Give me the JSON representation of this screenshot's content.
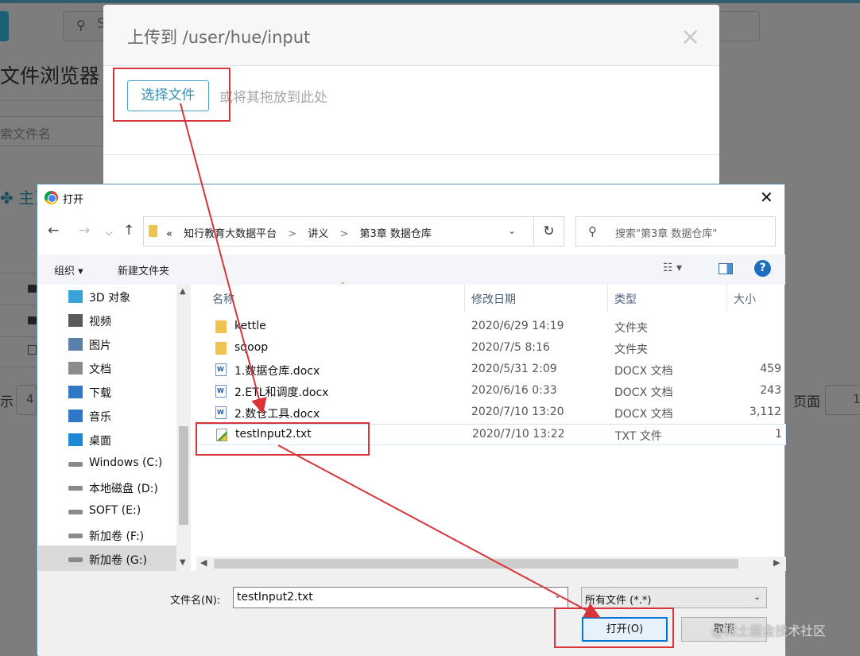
{
  "background": {
    "search_letter": "S",
    "title": "文件浏览器",
    "filter_placeholder": "索文件名",
    "home_label": "主页",
    "show_label": "示",
    "show_value": "4",
    "page_label": "页面",
    "page_value": "1"
  },
  "upload_modal": {
    "title": "上传到 /user/hue/input",
    "close_glyph": "×",
    "choose_button": "选择文件",
    "drop_hint": "或将其拖放到此处"
  },
  "open_dialog": {
    "title": "打开",
    "close_glyph": "✕",
    "address": {
      "prefix": "«",
      "crumbs": [
        "知行教育大数据平台",
        "讲义",
        "第3章 数据仓库"
      ]
    },
    "search_placeholder": "搜索\"第3章 数据仓库\"",
    "toolbar": {
      "organize": "组织 ▾",
      "new_folder": "新建文件夹",
      "view_glyph": "☷ ▾",
      "help": "?"
    },
    "nav_items": [
      {
        "label": "3D 对象",
        "icon": "cube-3d-icon",
        "color": "#37a3d9"
      },
      {
        "label": "视频",
        "icon": "video-icon",
        "color": "#5a5a5a"
      },
      {
        "label": "图片",
        "icon": "picture-icon",
        "color": "#5a7fa8"
      },
      {
        "label": "文档",
        "icon": "document-icon",
        "color": "#8c8c8c"
      },
      {
        "label": "下载",
        "icon": "download-icon",
        "color": "#2f78c5"
      },
      {
        "label": "音乐",
        "icon": "music-icon",
        "color": "#2f78c5"
      },
      {
        "label": "桌面",
        "icon": "desktop-icon",
        "color": "#1e88d6"
      },
      {
        "label": "Windows (C:)",
        "icon": "windows-drive-icon",
        "color": "#8a8a8a"
      },
      {
        "label": "本地磁盘 (D:)",
        "icon": "drive-icon",
        "color": "#8a8a8a"
      },
      {
        "label": "SOFT (E:)",
        "icon": "drive-icon",
        "color": "#8a8a8a"
      },
      {
        "label": "新加卷 (F:)",
        "icon": "drive-icon",
        "color": "#8a8a8a"
      },
      {
        "label": "新加卷 (G:)",
        "icon": "drive-icon",
        "color": "#8a8a8a"
      }
    ],
    "columns": {
      "name": "名称",
      "date": "修改日期",
      "type": "类型",
      "size": "大小"
    },
    "files": [
      {
        "name": "kettle",
        "date": "2020/6/29 14:19",
        "type": "文件夹",
        "size": "",
        "icon": "folder"
      },
      {
        "name": "sqoop",
        "date": "2020/7/5 8:16",
        "type": "文件夹",
        "size": "",
        "icon": "folder"
      },
      {
        "name": "1.数据仓库.docx",
        "date": "2020/5/31 2:09",
        "type": "DOCX 文档",
        "size": "459",
        "icon": "doc"
      },
      {
        "name": "2.ETL和调度.docx",
        "date": "2020/6/16 0:33",
        "type": "DOCX 文档",
        "size": "243",
        "icon": "doc"
      },
      {
        "name": "2.数仓工具.docx",
        "date": "2020/7/10 13:20",
        "type": "DOCX 文档",
        "size": "3,112",
        "icon": "doc"
      },
      {
        "name": "testInput2.txt",
        "date": "2020/7/10 13:22",
        "type": "TXT 文件",
        "size": "1",
        "icon": "txt"
      }
    ],
    "filename_label": "文件名(N):",
    "filename_value": "testInput2.txt",
    "filetype_value": "所有文件 (*.*)",
    "open_button": "打开(O)",
    "cancel_button": "取消"
  },
  "watermark": "@稀土掘金技术社区",
  "annotation_color": "#d9343a"
}
